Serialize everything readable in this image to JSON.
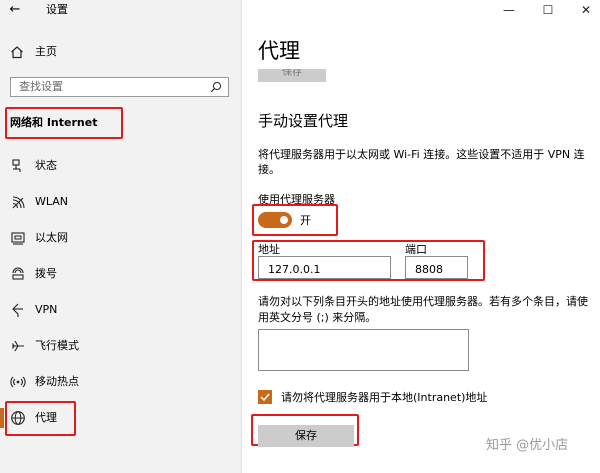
{
  "window": {
    "title": "设置",
    "back_glyph": "←",
    "minimize_glyph": "—",
    "maximize_glyph": "☐",
    "close_glyph": "✕"
  },
  "sidebar": {
    "home_label": "主页",
    "search_placeholder": "查找设置",
    "section_title": "网络和 Internet",
    "items": [
      {
        "label": "状态",
        "icon": "status-icon"
      },
      {
        "label": "WLAN",
        "icon": "wifi-icon"
      },
      {
        "label": "以太网",
        "icon": "ethernet-icon"
      },
      {
        "label": "拨号",
        "icon": "dialup-icon"
      },
      {
        "label": "VPN",
        "icon": "vpn-icon"
      },
      {
        "label": "飞行模式",
        "icon": "airplane-icon"
      },
      {
        "label": "移动热点",
        "icon": "hotspot-icon"
      },
      {
        "label": "代理",
        "icon": "globe-icon"
      }
    ]
  },
  "main": {
    "page_title": "代理",
    "top_save_label": "保存",
    "section_title": "手动设置代理",
    "description": [
      "将代理服务器用于以太网或 Wi-Fi 连接。这些设置不适用于 VPN 连",
      "接。"
    ],
    "toggle_caption": "使用代理服务器",
    "toggle_state": "开",
    "toggle_on": true,
    "address_label": "地址",
    "address_value": "127.0.0.1",
    "port_label": "端口",
    "port_value": "8808",
    "exceptions_hint": [
      "请勿对以下列条目开头的地址使用代理服务器。若有多个条目，请使",
      "用英文分号 (;) 来分隔。"
    ],
    "exceptions_value": "",
    "bypass_local_label": "请勿将代理服务器用于本地(Intranet)地址",
    "bypass_local_checked": true,
    "save_label": "保存"
  },
  "watermark": "知乎 @优小店",
  "colors": {
    "accent": "#c96a1b",
    "highlight_box": "#e21a1a",
    "sidebar_bg": "#f2f2f2",
    "button_bg": "#cccccc"
  }
}
